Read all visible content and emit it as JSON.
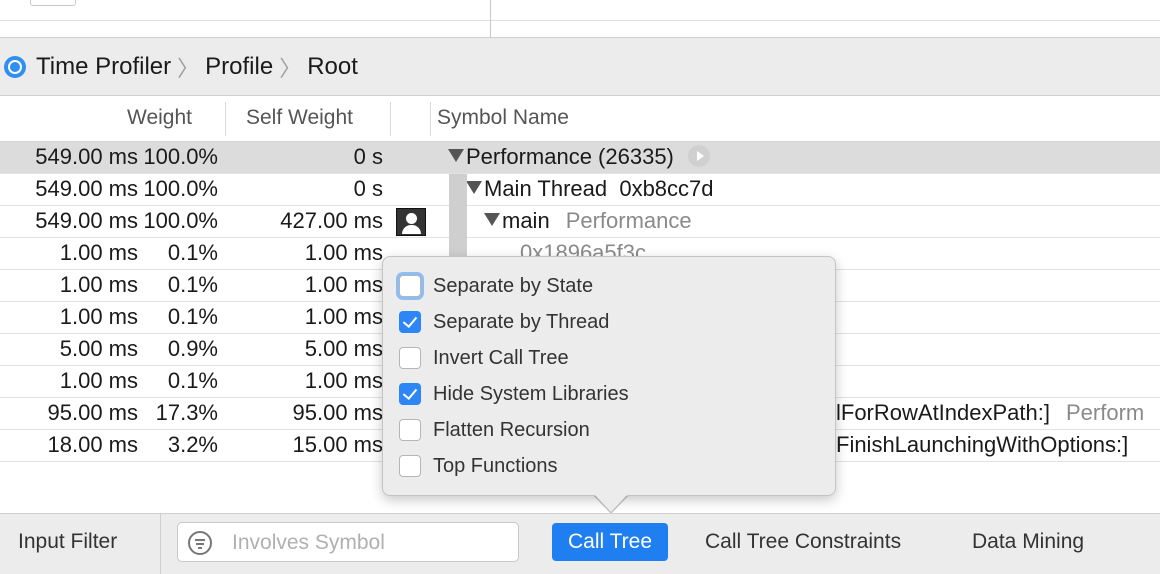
{
  "breadcrumb": {
    "items": [
      "Time Profiler",
      "Profile",
      "Root"
    ]
  },
  "columns": {
    "weight": "Weight",
    "self_weight": "Self Weight",
    "symbol_name": "Symbol Name"
  },
  "rows": [
    {
      "weight": "549.00 ms",
      "percent": "100.0%",
      "self_weight": "0 s",
      "symbol": "Performance (26335)",
      "library": ""
    },
    {
      "weight": "549.00 ms",
      "percent": "100.0%",
      "self_weight": "0 s",
      "symbol": "Main Thread  0xb8cc7d",
      "library": ""
    },
    {
      "weight": "549.00 ms",
      "percent": "100.0%",
      "self_weight": "427.00 ms",
      "symbol": "main",
      "library": "Performance"
    },
    {
      "weight": "1.00 ms",
      "percent": "0.1%",
      "self_weight": "1.00 ms",
      "symbol": "0x1896a5f3c",
      "library": ""
    },
    {
      "weight": "1.00 ms",
      "percent": "0.1%",
      "self_weight": "1.00 ms",
      "symbol": "",
      "library": ""
    },
    {
      "weight": "1.00 ms",
      "percent": "0.1%",
      "self_weight": "1.00 ms",
      "symbol": "",
      "library": ""
    },
    {
      "weight": "5.00 ms",
      "percent": "0.9%",
      "self_weight": "5.00 ms",
      "symbol": "",
      "library": ""
    },
    {
      "weight": "1.00 ms",
      "percent": "0.1%",
      "self_weight": "1.00 ms",
      "symbol": "",
      "library": ""
    },
    {
      "weight": "95.00 ms",
      "percent": "17.3%",
      "self_weight": "95.00 ms",
      "symbol": "lForRowAtIndexPath:]",
      "library": "Perform"
    },
    {
      "weight": "18.00 ms",
      "percent": "3.2%",
      "self_weight": "15.00 ms",
      "symbol": "FinishLaunchingWithOptions:]",
      "library": ""
    }
  ],
  "popover": {
    "options": [
      {
        "label": "Separate by State",
        "checked": false
      },
      {
        "label": "Separate by Thread",
        "checked": true
      },
      {
        "label": "Invert Call Tree",
        "checked": false
      },
      {
        "label": "Hide System Libraries",
        "checked": true
      },
      {
        "label": "Flatten Recursion",
        "checked": false
      },
      {
        "label": "Top Functions",
        "checked": false
      }
    ]
  },
  "bottom_bar": {
    "input_filter": "Input Filter",
    "search_placeholder": "Involves Symbol",
    "call_tree": "Call Tree",
    "call_tree_constraints": "Call Tree Constraints",
    "data_mining": "Data Mining"
  },
  "colors": {
    "accent": "#1f7ff0",
    "selected_row": "#dcdcdc"
  }
}
